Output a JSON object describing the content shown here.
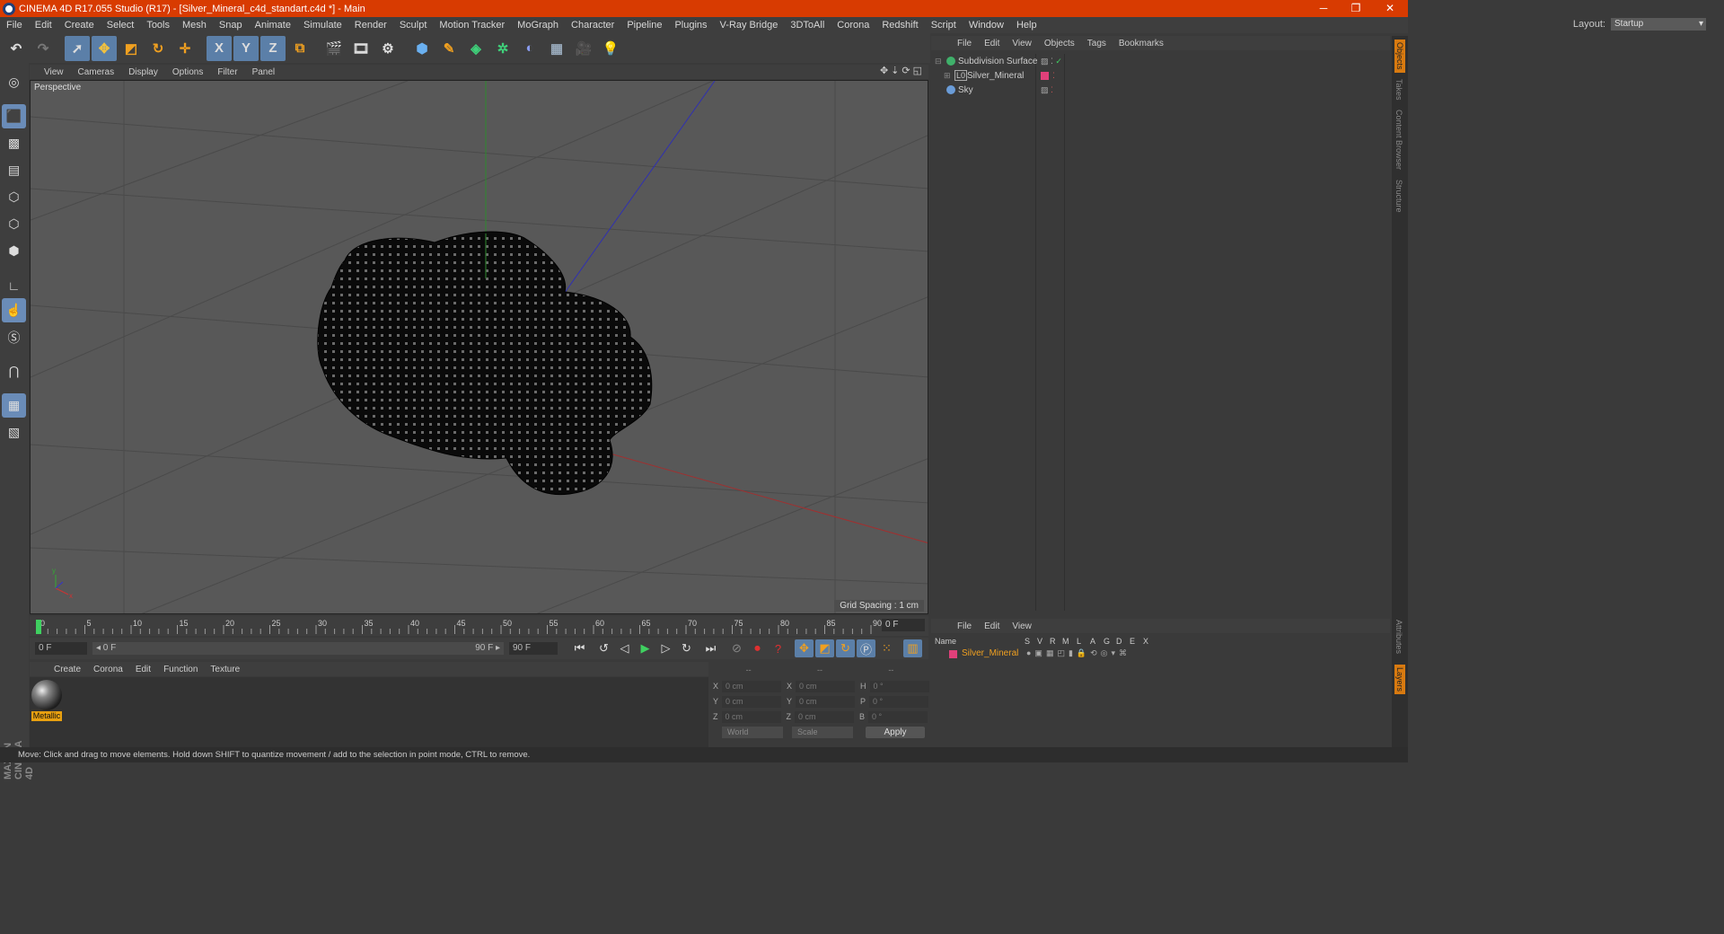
{
  "title_bar": {
    "title": "CINEMA 4D R17.055 Studio (R17) - [Silver_Mineral_c4d_standart.c4d *] - Main",
    "minimize": "─",
    "restore": "❐",
    "close": "✕"
  },
  "menu": [
    "File",
    "Edit",
    "Create",
    "Select",
    "Tools",
    "Mesh",
    "Snap",
    "Animate",
    "Simulate",
    "Render",
    "Sculpt",
    "Motion Tracker",
    "MoGraph",
    "Character",
    "Pipeline",
    "Plugins",
    "V-Ray Bridge",
    "3DToAll",
    "Corona",
    "Redshift",
    "Script",
    "Window",
    "Help"
  ],
  "layout": {
    "label": "Layout:",
    "value": "Startup"
  },
  "top_toolbar": {
    "axis_x": "X",
    "axis_y": "Y",
    "axis_z": "Z"
  },
  "viewport": {
    "menu": [
      "View",
      "Cameras",
      "Display",
      "Options",
      "Filter",
      "Panel"
    ],
    "camera_label": "Perspective",
    "grid_spacing": "Grid Spacing : 1 cm",
    "nav_icons": "✥⇣⟳◱"
  },
  "timeline": {
    "ticks": [
      "0",
      "5",
      "10",
      "15",
      "20",
      "25",
      "30",
      "35",
      "40",
      "45",
      "50",
      "55",
      "60",
      "65",
      "70",
      "75",
      "80",
      "85",
      "90"
    ],
    "current_frame": "0 F"
  },
  "transport": {
    "start": "0 F",
    "range_start": "◂ 0 F",
    "range_end": "90 F ▸",
    "end": "90 F"
  },
  "material_manager": {
    "menu": [
      "Create",
      "Corona",
      "Edit",
      "Function",
      "Texture"
    ],
    "material_name": "Metallic"
  },
  "coordinates": {
    "header": [
      "--",
      "--",
      "--"
    ],
    "rows": [
      {
        "a": "X",
        "av": "0 cm",
        "b": "X",
        "bv": "0 cm",
        "c": "H",
        "cv": "0 °"
      },
      {
        "a": "Y",
        "av": "0 cm",
        "b": "Y",
        "bv": "0 cm",
        "c": "P",
        "cv": "0 °"
      },
      {
        "a": "Z",
        "av": "0 cm",
        "b": "Z",
        "bv": "0 cm",
        "c": "B",
        "cv": "0 °"
      }
    ],
    "space": "World",
    "mode": "Scale",
    "apply": "Apply"
  },
  "object_manager": {
    "menu": [
      "File",
      "Edit",
      "View",
      "Objects",
      "Tags",
      "Bookmarks"
    ],
    "objects": [
      {
        "name": "Subdivision Surface",
        "icon_color": "#3fb06a"
      },
      {
        "name": "Silver_Mineral",
        "icon_color": "#888888"
      },
      {
        "name": "Sky",
        "icon_color": "#6a9cd8"
      }
    ]
  },
  "right_tabs": [
    "Objects",
    "Takes",
    "Content Browser",
    "Structure"
  ],
  "right_tabs_bottom": [
    "Attributes",
    "Layers"
  ],
  "layer_manager": {
    "menu": [
      "File",
      "Edit",
      "View"
    ],
    "columns": [
      "Name",
      "S",
      "V",
      "R",
      "M",
      "L",
      "A",
      "G",
      "D",
      "E",
      "X"
    ],
    "layer_name": "Silver_Mineral",
    "layer_color": "#e0407a"
  },
  "status_bar": "Move: Click and drag to move elements. Hold down SHIFT to quantize movement / add to the selection in point mode, CTRL to remove.",
  "branding": "MAXON CINEMA 4D"
}
